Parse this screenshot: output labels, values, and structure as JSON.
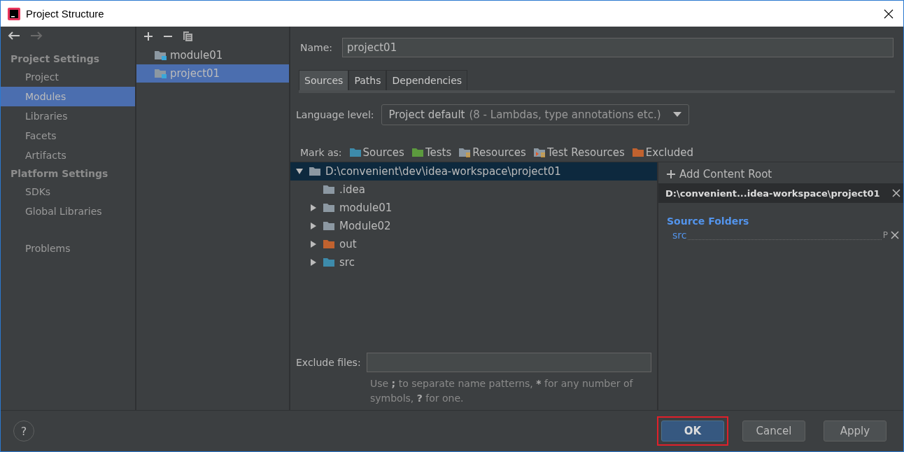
{
  "window": {
    "title": "Project Structure"
  },
  "nav": {
    "sections": [
      {
        "heading": "Project Settings",
        "items": [
          {
            "label": "Project",
            "selected": false
          },
          {
            "label": "Modules",
            "selected": true
          },
          {
            "label": "Libraries",
            "selected": false
          },
          {
            "label": "Facets",
            "selected": false
          },
          {
            "label": "Artifacts",
            "selected": false
          }
        ]
      },
      {
        "heading": "Platform Settings",
        "items": [
          {
            "label": "SDKs",
            "selected": false
          },
          {
            "label": "Global Libraries",
            "selected": false
          }
        ]
      }
    ],
    "extra": [
      {
        "label": "Problems",
        "selected": false
      }
    ]
  },
  "modules": [
    {
      "label": "module01",
      "selected": false
    },
    {
      "label": "project01",
      "selected": true
    }
  ],
  "name_field": {
    "label": "Name:",
    "value": "project01"
  },
  "tabs": [
    {
      "label": "Sources",
      "selected": true
    },
    {
      "label": "Paths",
      "selected": false
    },
    {
      "label": "Dependencies",
      "selected": false
    }
  ],
  "language_level": {
    "label": "Language level:",
    "value": "Project default",
    "detail": "(8 - Lambdas, type annotations etc.)"
  },
  "mark_as": {
    "label": "Mark as:",
    "items": [
      {
        "label": "Sources",
        "color": "#3d8bab",
        "kind": "plain"
      },
      {
        "label": "Tests",
        "color": "#5c9a3e",
        "kind": "plain"
      },
      {
        "label": "Resources",
        "color": "#8c98a2",
        "kind": "resource"
      },
      {
        "label": "Test Resources",
        "color": "#8c98a2",
        "kind": "test-resource"
      },
      {
        "label": "Excluded",
        "color": "#c1622f",
        "kind": "plain"
      }
    ]
  },
  "tree": [
    {
      "label": "D:\\convenient\\dev\\idea-workspace\\project01",
      "color": "#8c98a2",
      "expanded": true,
      "selected": true,
      "leaf": false,
      "children": [
        {
          "label": ".idea",
          "color": "#8c98a2",
          "expanded": false,
          "selected": false,
          "leaf": true
        },
        {
          "label": "module01",
          "color": "#8c98a2",
          "expanded": false,
          "selected": false,
          "leaf": false
        },
        {
          "label": "Module02",
          "color": "#8c98a2",
          "expanded": false,
          "selected": false,
          "leaf": false
        },
        {
          "label": "out",
          "color": "#c1622f",
          "expanded": false,
          "selected": false,
          "leaf": false
        },
        {
          "label": "src",
          "color": "#3d8bab",
          "expanded": false,
          "selected": false,
          "leaf": false
        }
      ]
    }
  ],
  "exclude_files": {
    "label": "Exclude files:",
    "hint": "Use **;** to separate name patterns, ***** for any number of symbols, **?** for one."
  },
  "content_roots": {
    "add_label": "Add Content Root",
    "root": "D:\\convenient...idea-workspace\\project01",
    "section": "Source Folders",
    "folders": [
      {
        "label": "src",
        "badge": "P"
      }
    ]
  },
  "help": {
    "label": "?"
  },
  "buttons": [
    {
      "label": "OK",
      "default": true,
      "highlighted": true
    },
    {
      "label": "Cancel",
      "default": false,
      "highlighted": false
    },
    {
      "label": "Apply",
      "default": false,
      "highlighted": false
    }
  ]
}
